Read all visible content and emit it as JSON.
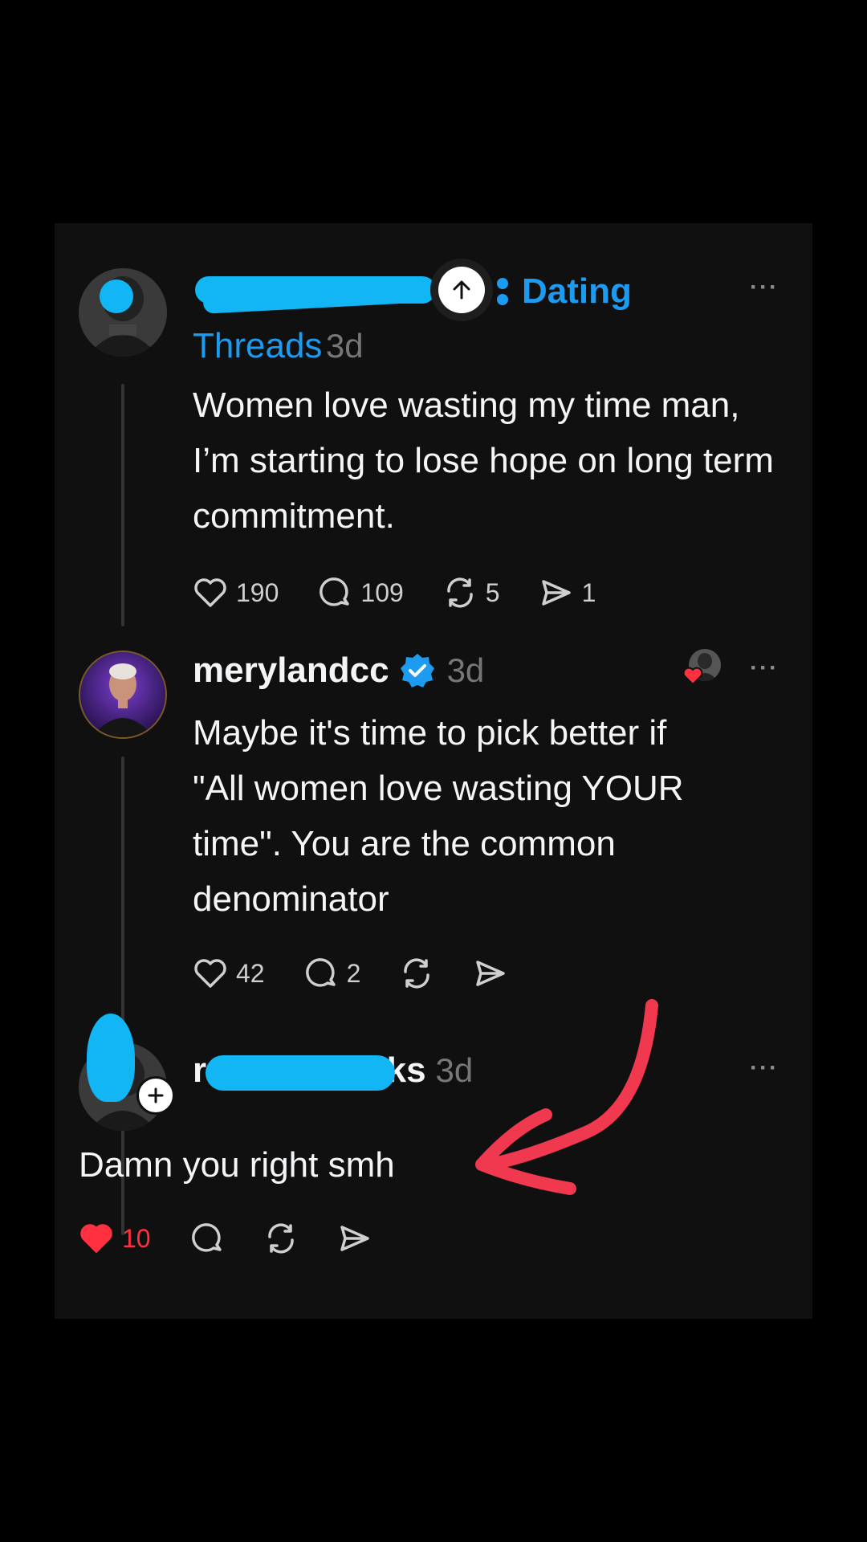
{
  "post": {
    "community_line1": "Dating",
    "community_line2": "Threads",
    "time": "3d",
    "text": "Women love wasting my time man, I’m starting to lose hope on long term commitment.",
    "likes": "190",
    "comments": "109",
    "reposts": "5",
    "shares": "1",
    "more": "···"
  },
  "reply1": {
    "username": "merylandcc",
    "verified": true,
    "time": "3d",
    "text_lines": [
      "Maybe it's time to pick better if",
      "\"All women love wasting YOUR",
      "time\". You are the common",
      "denominator"
    ],
    "likes": "42",
    "comments": "2",
    "more": "···"
  },
  "reply2": {
    "username_visible_start": "r",
    "username_visible_end": "0ks",
    "time": "3d",
    "text": "Damn you right smh",
    "likes": "10",
    "liked": true,
    "more": "···"
  },
  "colors": {
    "accent_blue": "#1d9bf0",
    "redaction_blue": "#12b6f5",
    "like_red": "#ff3040",
    "annotation_arrow": "#f0384f",
    "card_bg": "#101010"
  },
  "icons": [
    "heart-icon",
    "comment-icon",
    "repost-icon",
    "share-icon",
    "more-icon",
    "verified-badge-icon",
    "scroll-up-icon",
    "follow-plus-icon",
    "arrow-annotation"
  ]
}
